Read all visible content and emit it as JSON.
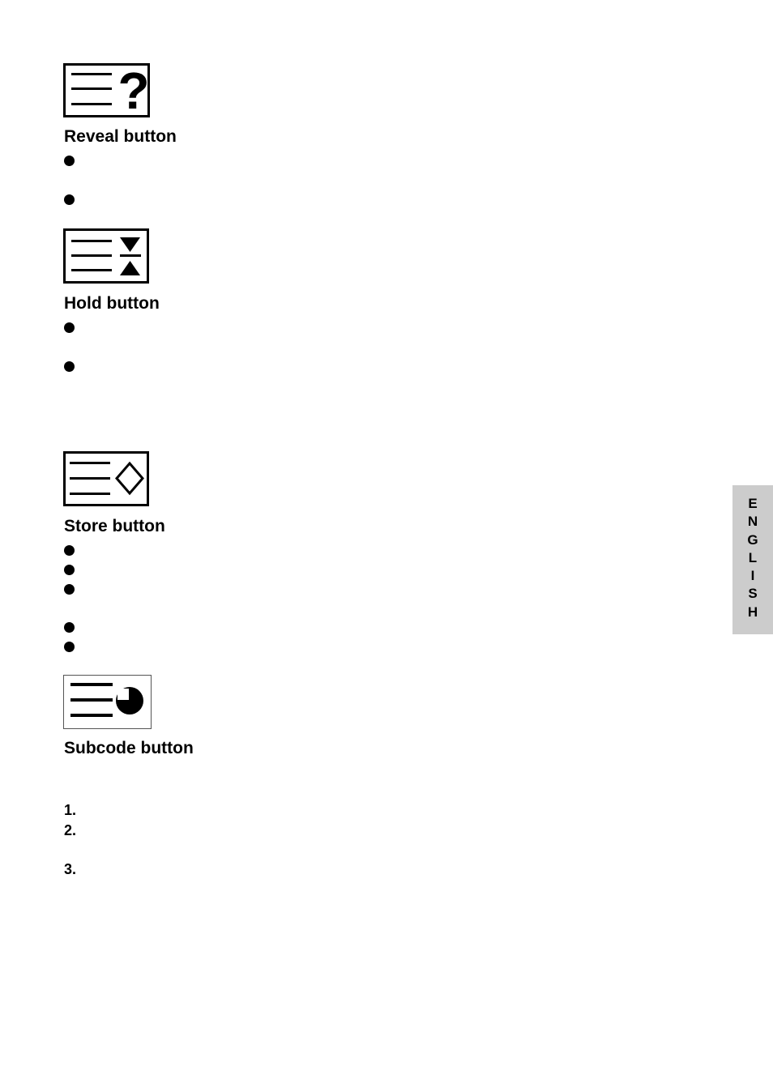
{
  "sections": [
    {
      "id": "reveal",
      "title": "Reveal button",
      "icon": "reveal-icon",
      "bullet_count": 2
    },
    {
      "id": "hold",
      "title": "Hold button",
      "icon": "hold-icon",
      "bullet_count": 2
    },
    {
      "id": "store",
      "title": "Store button",
      "icon": "store-icon",
      "bullet_count": 5
    },
    {
      "id": "subcode",
      "title": "Subcode button",
      "icon": "subcode-icon",
      "steps": [
        "1.",
        "2.",
        "3."
      ]
    }
  ],
  "language_tab": {
    "letters": [
      "E",
      "N",
      "G",
      "L",
      "I",
      "S",
      "H"
    ],
    "color": "#cccccc"
  }
}
